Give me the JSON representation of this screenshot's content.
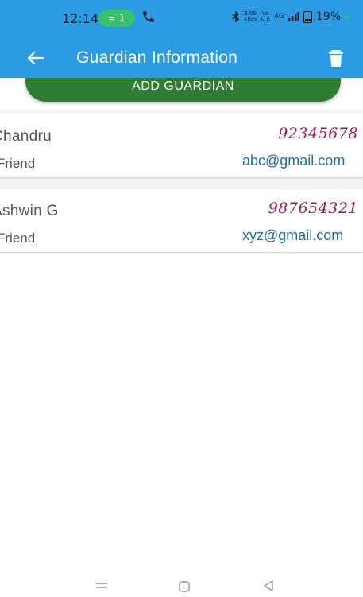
{
  "status_bar": {
    "time": "12:14",
    "hotspot_count": "1",
    "net_speed_value": "3.00",
    "net_speed_unit": "KB/S",
    "volte": "Vo LTE",
    "signal": "4G",
    "battery": "19%"
  },
  "app_bar": {
    "title": "Guardian Information",
    "background": "#2b9be3"
  },
  "add_button": {
    "label": "ADD GUARDIAN",
    "color": "#2e7d32"
  },
  "guardians": [
    {
      "name": "Chandru",
      "relation": "Friend",
      "phone": "92345678",
      "email": "abc@gmail.com"
    },
    {
      "name": "Ashwin G",
      "relation": "Friend",
      "phone": "987654321",
      "email": "xyz@gmail.com"
    }
  ],
  "icons": {
    "back": "arrow-left-icon",
    "delete": "trash-icon",
    "call": "phone-icon",
    "bluetooth": "bluetooth-icon",
    "nav_menu": "menu-icon",
    "nav_home": "home-icon",
    "nav_back": "triangle-back-icon"
  }
}
